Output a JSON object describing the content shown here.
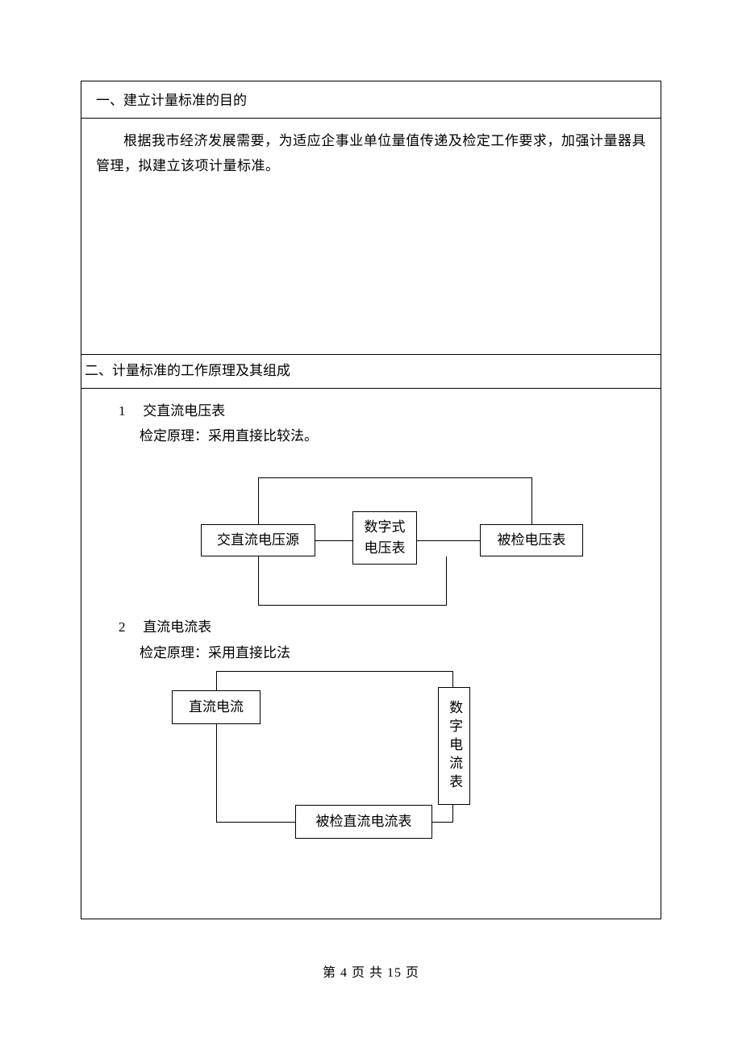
{
  "section1": {
    "heading": "一、建立计量标准的目的",
    "body": "根据我市经济发展需要，为适应企事业单位量值传递及检定工作要求，加强计量器具管理，拟建立该项计量标准。"
  },
  "section2": {
    "heading": "二、计量标准的工作原理及其组成",
    "item1": {
      "num": "1",
      "title": "交直流电压表",
      "principle": "检定原理：采用直接比较法。"
    },
    "item2": {
      "num": "2",
      "title": "直流电流表",
      "principle": "检定原理：采用直接比法"
    }
  },
  "diagram1": {
    "box_left": "交直流电压源",
    "box_mid": "数字式\n电压表",
    "box_right": "被检电压表"
  },
  "diagram2": {
    "box_source": "直流电流",
    "box_meter": "数字电流表",
    "box_bottom": "被检直流电流表"
  },
  "footer": "第 4 页 共 15 页"
}
